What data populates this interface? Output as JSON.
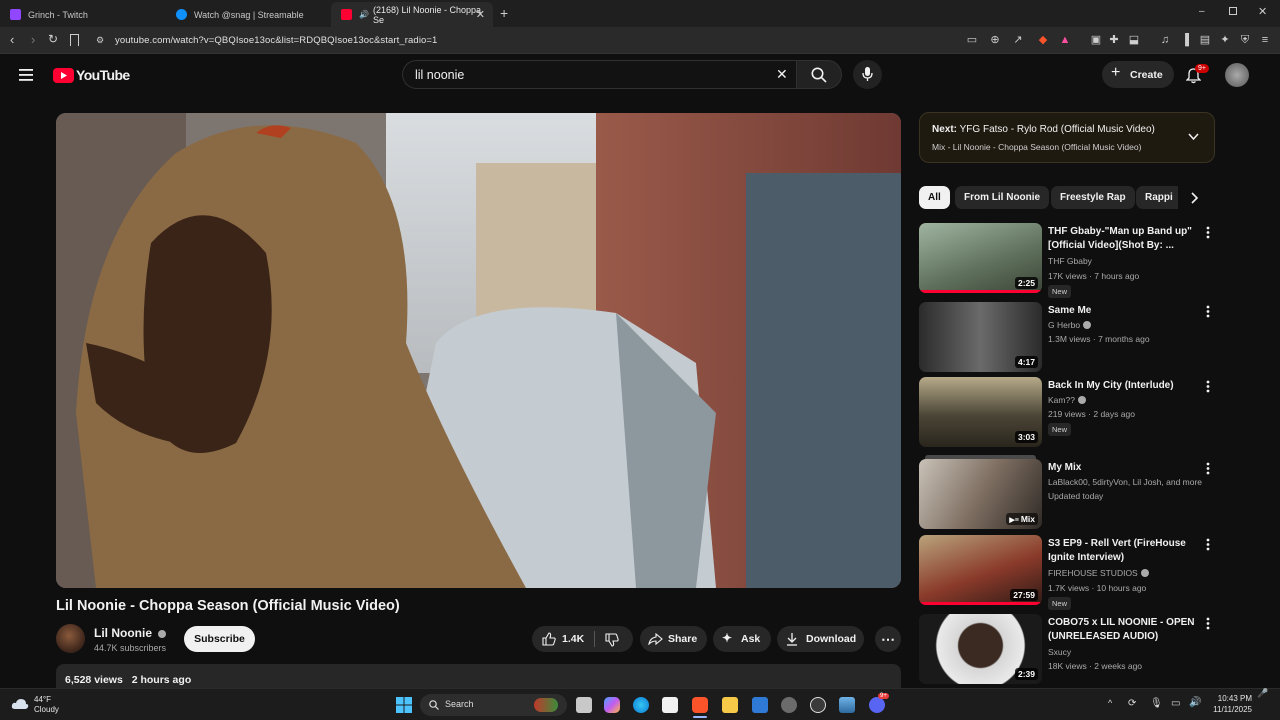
{
  "browser": {
    "tabs": [
      {
        "title": "Grinch - Twitch",
        "favicon_color": "#9146ff"
      },
      {
        "title": "Watch @snag | Streamable",
        "favicon_color": "#0f90fa"
      },
      {
        "title": "(2168) Lil Noonie - Choppa Se",
        "favicon_color": "#ff0033",
        "active": true
      }
    ],
    "new_tab_label": "+",
    "url": "youtube.com/watch?v=QBQIsoe13oc&list=RDQBQIsoe13oc&start_radio=1"
  },
  "header": {
    "logo_text": "YouTube",
    "search_query": "lil noonie",
    "create_label": "Create",
    "notification_count": "9+"
  },
  "video": {
    "title": "Lil Noonie - Choppa Season (Official Music Video)",
    "channel": "Lil Noonie",
    "subscribers": "44.7K subscribers",
    "subscribe_label": "Subscribe",
    "likes": "1.4K",
    "share_label": "Share",
    "ask_label": "Ask",
    "download_label": "Download",
    "views": "6,528 views",
    "age": "2 hours ago"
  },
  "up_next": {
    "prefix": "Next:",
    "title": "YFG Fatso - Rylo Rod (Official Music Video)",
    "mix": "Mix - Lil Noonie - Choppa Season (Official Music Video)"
  },
  "chips": [
    "All",
    "From Lil Noonie",
    "Freestyle Rap",
    "Rappi"
  ],
  "recommendations": [
    {
      "title_line1": "THF Gbaby-\"Man up Band up\"",
      "title_line2": "[Official Video](Shot By: ...",
      "channel": "THF Gbaby",
      "stats": "17K views · 7 hours ago",
      "badge": "New",
      "duration": "2:25",
      "verified": false
    },
    {
      "title_line1": "Same Me",
      "title_line2": "",
      "channel": "G Herbo",
      "stats": "1.3M views · 7 months ago",
      "badge": "",
      "duration": "4:17",
      "verified": true
    },
    {
      "title_line1": "Back In My City (Interlude)",
      "title_line2": "",
      "channel": "Kam??",
      "stats": "219 views · 2 days ago",
      "badge": "New",
      "duration": "3:03",
      "verified": true
    },
    {
      "title_line1": "My Mix",
      "title_line2": "",
      "channel": "LaBlack00, 5dirtyVon, Lil Josh, and more",
      "stats": "Updated today",
      "badge": "",
      "duration": "Mix",
      "verified": false
    },
    {
      "title_line1": "S3 EP9 - Rell Vert (FireHouse",
      "title_line2": "Ignite Interview)",
      "channel": "FIREHOUSE STUDIOS",
      "stats": "1.7K views · 10 hours ago",
      "badge": "New",
      "duration": "27:59",
      "verified": true
    },
    {
      "title_line1": "COBO75 x LIL NOONIE - OPEN",
      "title_line2": "(UNRELEASED AUDIO)",
      "channel": "Sxucy",
      "stats": "18K views · 2 weeks ago",
      "badge": "",
      "duration": "2:39",
      "verified": false
    }
  ],
  "taskbar": {
    "temperature": "44°F",
    "weather": "Cloudy",
    "search_label": "Search",
    "time": "10:43 PM",
    "date": "11/11/2025",
    "discord_badge": "9+"
  }
}
